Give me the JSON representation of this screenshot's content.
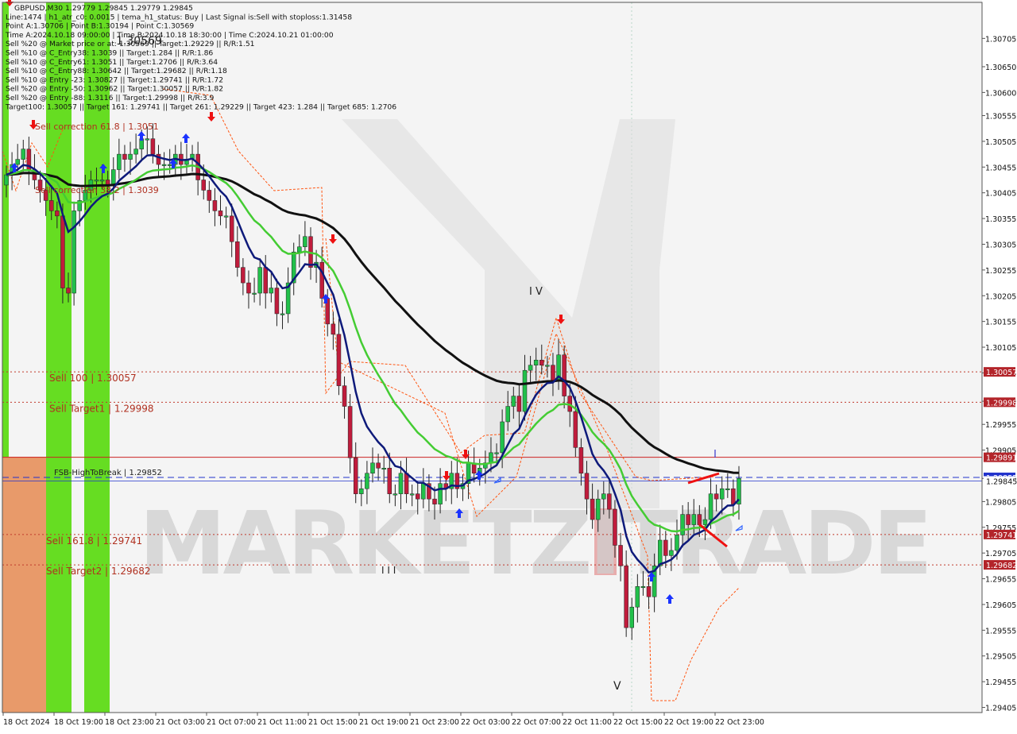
{
  "colors": {
    "background": "#f4f4f4",
    "bull": "#21c04a",
    "bear": "#c01c3c",
    "ema_fast": "#0e1a7a",
    "ema_mid": "#44cc33",
    "ema_slow": "#111111",
    "fib_sell": "#c0392b",
    "fsb_line": "#2233cc",
    "zone_green": "#66dd22",
    "zone_orange": "#e89a6a",
    "zone_pink": "#e5a0a0",
    "channel": "#ff5511"
  },
  "header": {
    "lines": [
      "GBPUSD,M30  1.29779 1.29845 1.29779 1.29845",
      "Line:1474 | h1_atr_c0: 0.0015 | tema_h1_status: Buy | Last Signal is:Sell with stoploss:1.31458",
      "Point A:1.30706 | Point B:1.30194 | Point C:1.30569",
      "Time A:2024.10.18 09:00:00 | Time B:2024.10.18 18:30:00 | Time C:2024.10.21 01:00:00",
      "Sell %20 @ Market price or at: 1.30569 || Target:1.29229 || R/R:1.51",
      "Sell %10 @ C_Entry38: 1.3039 || Target:1.284 || R/R:1.86",
      "Sell %10 @ C_Entry61: 1.3051 || Target:1.2706 || R/R:3.64",
      "Sell %10 @ C_Entry88: 1.30642 || Target:1.29682 || R/R:1.18",
      "Sell %10 @ Entry -23: 1.30827 || Target:1.29741 || R/R:1.72",
      "Sell %20 @ Entry -50: 1.30962 || Target:1.30057 || R/R:1.82",
      "Sell %20 @ Entry -88: 1.3116 || Target:1.29998 || R/R:3.9",
      "Target100: 1.30057 || Target 161: 1.29741 || Target 261: 1.29229 || Target 423: 1.284 || Target 685: 1.2706"
    ]
  },
  "annotations": {
    "point_c_label": "1.30569",
    "sell_correction_618": "Sell correction 61.8 | 1.3051",
    "sell_correction_382": "Sell correction 38.2 | 1.3039",
    "wave_iv": "I V",
    "wave_iii": "I I I",
    "wave_v": "V",
    "watermark": "MARKETZITRADE"
  },
  "levels": [
    {
      "label": "Sell 100 | 1.30057",
      "price": 1.30057,
      "tag": "1.30057",
      "style": "dotted"
    },
    {
      "label": "Sell Target1 | 1.29998",
      "price": 1.29998,
      "tag": "1.29998",
      "style": "dotted"
    },
    {
      "label": "",
      "price": 1.29891,
      "tag": "1.29891",
      "style": "solid"
    },
    {
      "label": "FSB-HighToBreak | 1.29852",
      "price": 1.29852,
      "tag": "1.29852",
      "style": "dashed"
    },
    {
      "label": "Sell 161.8 | 1.29741",
      "price": 1.29741,
      "tag": "1.29741",
      "style": "dotted"
    },
    {
      "label": "Sell Target2 | 1.29682",
      "price": 1.29682,
      "tag": "1.29682",
      "style": "dotted"
    }
  ],
  "chart_data": {
    "type": "candlestick",
    "symbol": "GBPUSD",
    "timeframe": "M30",
    "ylim": [
      1.29395,
      1.30775
    ],
    "y_ticks": [
      "1.30705",
      "1.30650",
      "1.30600",
      "1.30555",
      "1.30505",
      "1.30455",
      "1.30405",
      "1.30355",
      "1.30305",
      "1.30255",
      "1.30205",
      "1.30155",
      "1.30105",
      "1.30055",
      "1.30000",
      "1.29955",
      "1.29905",
      "1.29850",
      "1.29805",
      "1.29755",
      "1.29705",
      "1.29655",
      "1.29605",
      "1.29555",
      "1.29505",
      "1.29455",
      "1.29405"
    ],
    "x_ticks": [
      "18 Oct 2024",
      "18 Oct 19:00",
      "18 Oct 23:00",
      "21 Oct 03:00",
      "21 Oct 07:00",
      "21 Oct 11:00",
      "21 Oct 15:00",
      "21 Oct 19:00",
      "21 Oct 23:00",
      "22 Oct 03:00",
      "22 Oct 07:00",
      "22 Oct 11:00",
      "22 Oct 15:00",
      "22 Oct 19:00",
      "22 Oct 23:00"
    ],
    "current_price": 1.29845,
    "current_price_tag": "1.29845",
    "close": [
      1.3044,
      1.3046,
      1.3047,
      1.3049,
      1.3045,
      1.3043,
      1.3041,
      1.3039,
      1.3037,
      1.3036,
      1.3022,
      1.3021,
      1.3037,
      1.3039,
      1.3041,
      1.3043,
      1.3043,
      1.3043,
      1.3042,
      1.3045,
      1.3048,
      1.3047,
      1.3048,
      1.3049,
      1.3051,
      1.3051,
      1.3048,
      1.3046,
      1.3046,
      1.3046,
      1.3048,
      1.3046,
      1.3047,
      1.3048,
      1.3043,
      1.3041,
      1.3039,
      1.3037,
      1.3036,
      1.3036,
      1.3031,
      1.3026,
      1.3023,
      1.3021,
      1.3021,
      1.3026,
      1.3021,
      1.3022,
      1.3017,
      1.3017,
      1.3023,
      1.3029,
      1.303,
      1.3032,
      1.3026,
      1.3027,
      1.302,
      1.3015,
      1.3013,
      1.3003,
      1.2999,
      1.2989,
      1.2982,
      1.2983,
      1.2986,
      1.2988,
      1.2987,
      1.2987,
      1.2982,
      1.2982,
      1.2986,
      1.2982,
      1.2982,
      1.2981,
      1.2984,
      1.2981,
      1.298,
      1.2984,
      1.2983,
      1.2986,
      1.2983,
      1.2984,
      1.2988,
      1.2986,
      1.2987,
      1.2988,
      1.299,
      1.299,
      1.2996,
      1.2999,
      1.3001,
      1.2998,
      1.3006,
      1.3007,
      1.3008,
      1.3007,
      1.3007,
      1.3004,
      1.3009,
      1.3001,
      1.2998,
      1.2991,
      1.2986,
      1.2981,
      1.2977,
      1.2981,
      1.2982,
      1.2979,
      1.2972,
      1.2968,
      1.2956,
      1.296,
      1.2964,
      1.2964,
      1.2962,
      1.2968,
      1.2973,
      1.297,
      1.2971,
      1.2974,
      1.2978,
      1.2976,
      1.2978,
      1.2976,
      1.2977,
      1.2982,
      1.2981,
      1.2983,
      1.2983,
      1.298,
      1.2985
    ]
  }
}
